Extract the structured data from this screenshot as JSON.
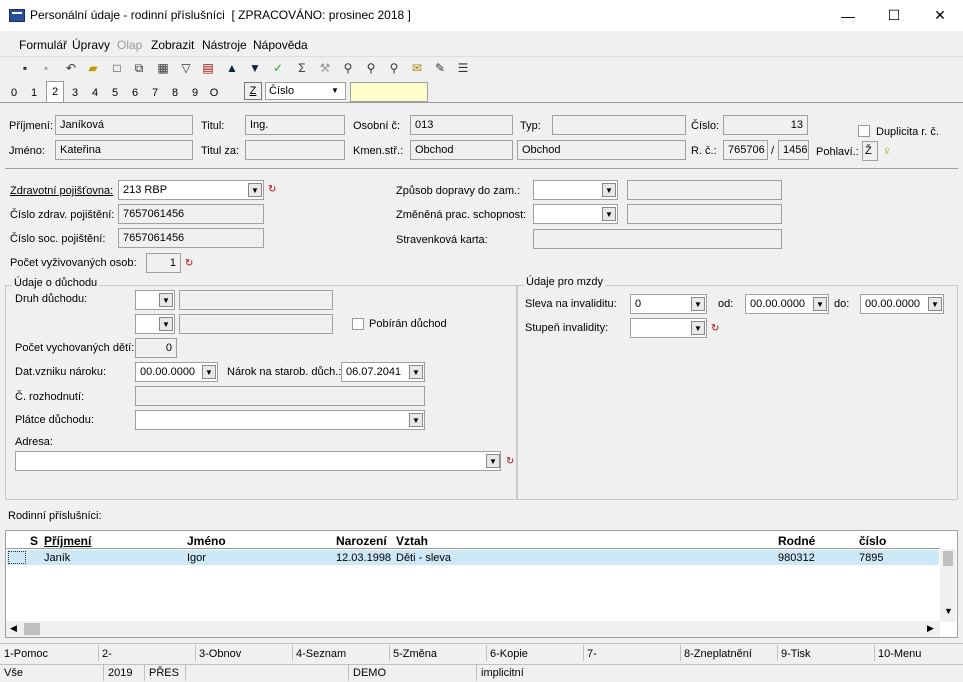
{
  "window": {
    "title": "Personální údaje - rodinní příslušníci",
    "status_tag": "[ ZPRACOVÁNO: prosinec 2018 ]",
    "minimize": "—",
    "maximize": "☐",
    "close": "✕"
  },
  "menu": [
    "Formulář",
    "Úpravy",
    "Olap",
    "Zobrazit",
    "Nástroje",
    "Nápověda"
  ],
  "tabs": [
    "0",
    "1",
    "2",
    "3",
    "4",
    "5",
    "6",
    "7",
    "8",
    "9",
    "O"
  ],
  "sort": {
    "z_label": "Z",
    "field": "Číslo",
    "search": ""
  },
  "header": {
    "prijmeni_label": "Příjmení:",
    "prijmeni": "Janíková",
    "titul_label": "Titul:",
    "titul": "Ing.",
    "osobni_label": "Osobní č:",
    "osobni": "013",
    "typ_label": "Typ:",
    "typ": "",
    "cislo_label": "Číslo:",
    "cislo": "13",
    "duplicita_label": "Duplicita r. č.",
    "jmeno_label": "Jméno:",
    "jmeno": "Kateřina",
    "titulza_label": "Titul za:",
    "titulza": "",
    "kmen_label": "Kmen.stř.:",
    "kmen_code": "Obchod",
    "kmen_name": "Obchod",
    "rc_label": "R. č.:",
    "rc1": "765706",
    "rc_slash": "/",
    "rc2": "1456",
    "pohlavi_label": "Pohlaví.:",
    "pohlavi": "Ž"
  },
  "health": {
    "pojistovna_label": "Zdravotní pojišťovna:",
    "pojistovna": "213 RBP",
    "cislo_zdrav_label": "Číslo zdrav. pojištění:",
    "cislo_zdrav": "7657061456",
    "cislo_soc_label": "Číslo soc. pojištění:",
    "cislo_soc": "7657061456",
    "vyzivovanych_label": "Počet vyživovaných osob:",
    "vyzivovanych": "1",
    "doprava_label": "Způsob dopravy do zam.:",
    "zmenena_label": "Změněná prac. schopnost:",
    "stravenka_label": "Stravenková karta:"
  },
  "duchod": {
    "section": "Údaje o důchodu",
    "druh_label": "Druh důchodu:",
    "pobiran_label": "Pobírán důchod",
    "deti_label": "Počet vychovaných dětí:",
    "deti": "0",
    "vznik_label": "Dat.vzniku nároku:",
    "vznik": "00.00.0000",
    "narok_label": "Nárok na starob. důch.:",
    "narok": "06.07.2041",
    "rozhodnuti_label": "Č. rozhodnutí:",
    "platce_label": "Plátce důchodu:",
    "adresa_label": "Adresa:"
  },
  "mzdy": {
    "section": "Údaje pro mzdy",
    "sleva_label": "Sleva na invaliditu:",
    "sleva": "0",
    "od_label": "od:",
    "od": "00.00.0000",
    "do_label": "do:",
    "do": "00.00.0000",
    "stupen_label": "Stupeň invalidity:"
  },
  "family": {
    "label": "Rodinní příslušníci:",
    "columns": [
      "S",
      "Příjmení",
      "Jméno",
      "Narození",
      "Vztah",
      "Rodné",
      "číslo"
    ],
    "rows": [
      {
        "prijmeni": "Janík",
        "jmeno": "Igor",
        "narozeni": "12.03.1998",
        "vztah": "Děti - sleva",
        "rodne": "980312",
        "cislo": "7895"
      }
    ]
  },
  "fnkeys": [
    "1-Pomoc",
    "2-",
    "3-Obnov",
    "4-Seznam",
    "5-Změna",
    "6-Kopie",
    "7-",
    "8-Zneplatnění",
    "9-Tisk",
    "10-Menu"
  ],
  "status": [
    "Vše",
    "2019",
    "PŘES",
    "DEMO",
    "implicitní"
  ]
}
